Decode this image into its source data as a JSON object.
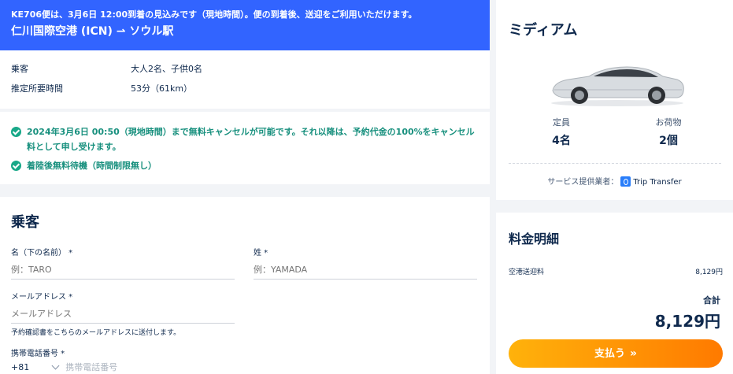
{
  "banner": {
    "flight_notice": "KE706便は、3月6日 12:00到着の見込みです（現地時間）。便の到着後、送迎をご利用いただけます。",
    "route": "仁川国際空港 (ICN) ⇀ ソウル駅"
  },
  "trip": [
    {
      "label": "乗客",
      "value": "大人2名、子供0名"
    },
    {
      "label": "推定所要時間",
      "value": "53分（61km）"
    }
  ],
  "policy": [
    "2024年3月6日 00:50（現地時間）まで無料キャンセルが可能です。それ以降は、予約代金の100%をキャンセル料として申し受けます。",
    "着陸後無料待機（時間制限無し）"
  ],
  "passenger": {
    "title": "乗客",
    "first_name_label": "名（下の名前） *",
    "first_name_placeholder": "例：TARO",
    "last_name_label": "姓 *",
    "last_name_placeholder": "例：YAMADA",
    "email_label": "メールアドレス *",
    "email_placeholder": "メールアドレス",
    "email_hint": "予約確認書をこちらのメールアドレスに送付します。",
    "phone_label": "携帯電話番号 *",
    "country_code": "+81",
    "phone_placeholder": "携帯電話番号"
  },
  "vehicle": {
    "class": "ミディアム",
    "capacity_label": "定員",
    "capacity_value": "4名",
    "luggage_label": "お荷物",
    "luggage_value": "2個",
    "provider_label": "サービス提供業者：",
    "provider_name": "Trip Transfer"
  },
  "price": {
    "title": "料金明細",
    "item_label": "空港送迎料",
    "item_amount": "8,129円",
    "total_label": "合計",
    "total_amount": "8,129円",
    "pay_button": "支払う"
  },
  "colors": {
    "accent": "#3264ff",
    "success": "#18907e",
    "pay_start": "#ffb20b",
    "pay_end": "#ff7a00"
  },
  "icons": [
    "check-circle-icon",
    "car-icon",
    "provider-logo-icon",
    "chevron-down-icon",
    "double-chevron-right-icon"
  ]
}
